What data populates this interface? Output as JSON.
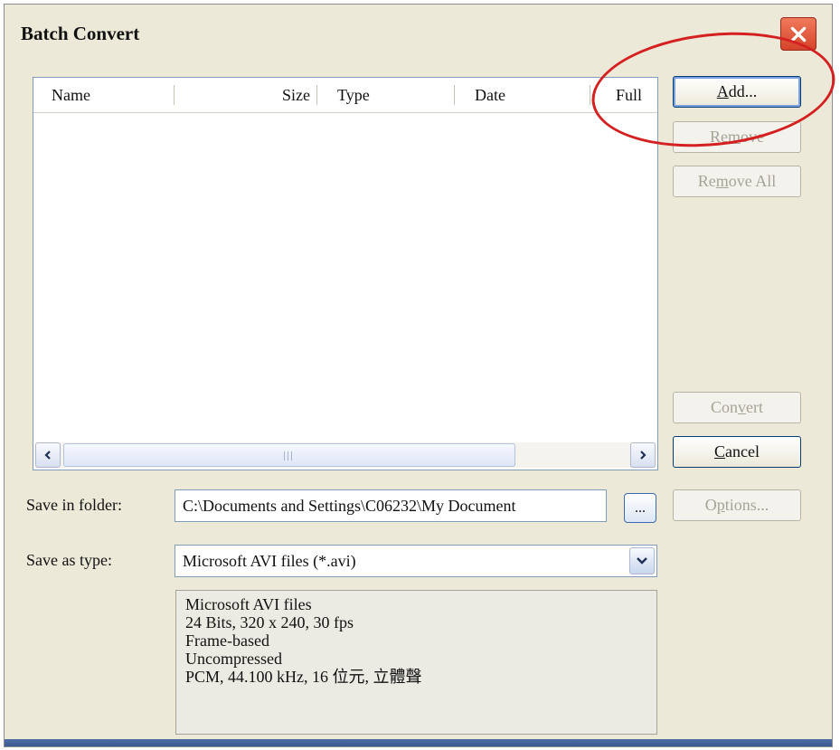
{
  "window": {
    "title": "Batch Convert"
  },
  "list": {
    "columns": [
      "Name",
      "Size",
      "Type",
      "Date",
      "Full"
    ],
    "rows": []
  },
  "buttons": {
    "add": "Add...",
    "remove": "Remove",
    "remove_all": "Remove All",
    "convert": "Convert",
    "cancel": "Cancel",
    "options": "Options...",
    "browse": "..."
  },
  "save_folder": {
    "label": "Save in folder:",
    "value": "C:\\Documents and Settings\\C06232\\My Document"
  },
  "save_type": {
    "label": "Save as type:",
    "value": "Microsoft AVI files (*.avi)"
  },
  "description": [
    "Microsoft AVI files",
    "24 Bits, 320 x 240, 30 fps",
    "Frame-based",
    "Uncompressed",
    "PCM, 44.100 kHz, 16 位元, 立體聲"
  ],
  "annotation": {
    "color": "#d42020"
  }
}
